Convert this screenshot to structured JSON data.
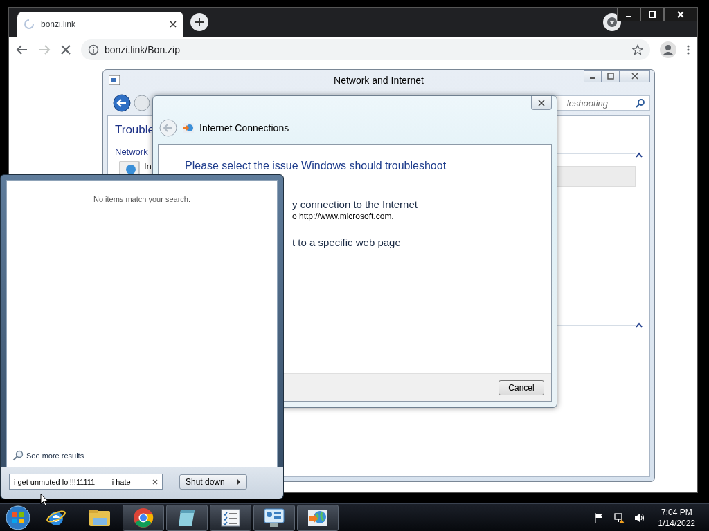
{
  "browser": {
    "tab": {
      "title": "bonzi.link",
      "loading": true
    },
    "forward": {
      "disabled": true
    },
    "address": "bonzi.link/Bon.zip"
  },
  "control_panel": {
    "title": "Network and Internet",
    "search": {
      "value": "leshooting"
    },
    "heading": "Trouble",
    "section": "Network",
    "item": "In"
  },
  "dialog": {
    "title": "Internet Connections",
    "prompt": "Please select the issue Windows should troubleshoot",
    "options": [
      {
        "title": "y connection to the Internet",
        "description": "o http://www.microsoft.com."
      },
      {
        "title": "t to a specific web page"
      }
    ],
    "cancel": "Cancel"
  },
  "start_menu": {
    "message": "No items match your search.",
    "see_more": "See more results",
    "search": {
      "value": "i get unmuted lol!!!11111        i hate"
    },
    "shutdown": "Shut down"
  },
  "taskbar": {
    "apps": [
      {
        "kind": "ie",
        "running": false
      },
      {
        "kind": "explorer",
        "running": false
      },
      {
        "kind": "chrome",
        "running": true
      },
      {
        "kind": "journal",
        "running": true
      },
      {
        "kind": "checklist",
        "running": true
      },
      {
        "kind": "control-panel",
        "running": true
      },
      {
        "kind": "troubleshooter",
        "running": true
      }
    ],
    "time": "7:04 PM",
    "date": "1/14/2022"
  }
}
